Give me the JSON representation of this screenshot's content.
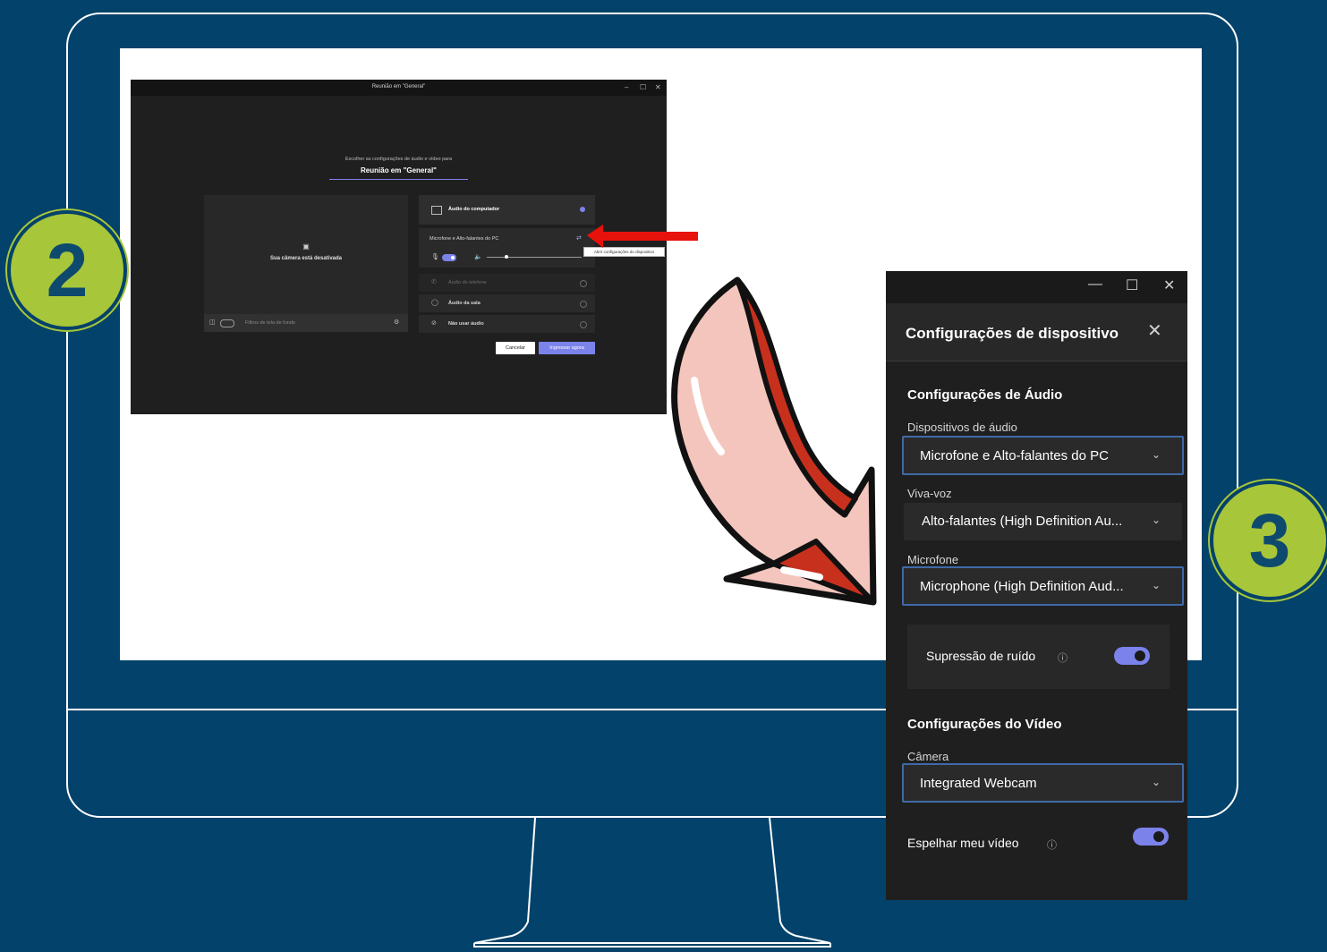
{
  "badges": {
    "step2": "2",
    "step3": "3"
  },
  "teams": {
    "window_title": "Reunião em \"General\"",
    "window_controls": [
      "–",
      "☐",
      "✕"
    ],
    "subtitle": "Escolher as configurações de áudio e vídeo para",
    "meeting_name": "Reunião em \"General\"",
    "camera_off_text": "Sua câmera está desativada",
    "background_filters": "Filtros de tela de fundo",
    "audio_options": {
      "computer_audio": "Áudio do computador",
      "device_name": "Microfone e Alto-falantes do PC",
      "tooltip": "Abrir configurações do dispositivo",
      "phone_audio": "Áudio do telefone",
      "room_audio": "Áudio da sala",
      "no_audio": "Não usar áudio"
    },
    "cancel_label": "Cancelar",
    "join_label": "Ingressar agora",
    "accent": "#7b83eb"
  },
  "device_settings": {
    "window_controls": [
      "—",
      "☐",
      "✕"
    ],
    "title": "Configurações de dispositivo",
    "audio_section": "Configurações de Áudio",
    "audio_devices_label": "Dispositivos de áudio",
    "audio_devices_value": "Microfone e Alto-falantes do PC",
    "speaker_label": "Viva-voz",
    "speaker_value": "Alto-falantes (High Definition Au...",
    "mic_label": "Microfone",
    "mic_value": "Microphone (High Definition Aud...",
    "noise_label": "Supressão de ruído",
    "noise_on": true,
    "video_section": "Configurações do Vídeo",
    "camera_label": "Câmera",
    "camera_value": "Integrated Webcam",
    "mirror_label": "Espelhar meu vídeo",
    "mirror_on": true,
    "highlight_color": "#3f6aa8"
  },
  "colors": {
    "background": "#03426a",
    "badge": "#a8c63a",
    "badge_text": "#0e4a6e",
    "arrow_red": "#e8120c"
  }
}
